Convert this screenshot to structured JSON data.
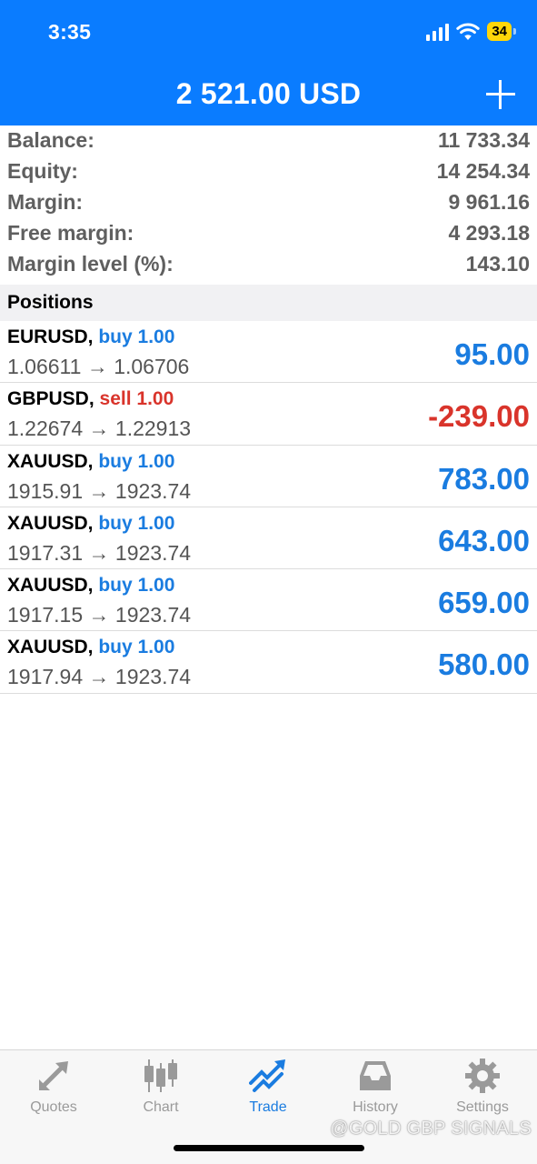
{
  "status_bar": {
    "time": "3:35",
    "battery": "34"
  },
  "header": {
    "title": "2 521.00 USD"
  },
  "summary": [
    {
      "label": "Balance:",
      "value": "11 733.34"
    },
    {
      "label": "Equity:",
      "value": "14 254.34"
    },
    {
      "label": "Margin:",
      "value": "9 961.16"
    },
    {
      "label": "Free margin:",
      "value": "4 293.18"
    },
    {
      "label": "Margin level (%):",
      "value": "143.10"
    }
  ],
  "positions_title": "Positions",
  "positions": [
    {
      "symbol": "EURUSD,",
      "direction": "buy 1.00",
      "prices": "1.06611 → 1.06706",
      "profit": "95.00"
    },
    {
      "symbol": "GBPUSD,",
      "direction": "sell 1.00",
      "prices": "1.22674 → 1.22913",
      "profit": "-239.00"
    },
    {
      "symbol": "XAUUSD,",
      "direction": "buy 1.00",
      "prices": "1915.91 → 1923.74",
      "profit": "783.00"
    },
    {
      "symbol": "XAUUSD,",
      "direction": "buy 1.00",
      "prices": "1917.31 → 1923.74",
      "profit": "643.00"
    },
    {
      "symbol": "XAUUSD,",
      "direction": "buy 1.00",
      "prices": "1917.15 → 1923.74",
      "profit": "659.00"
    },
    {
      "symbol": "XAUUSD,",
      "direction": "buy 1.00",
      "prices": "1917.94 → 1923.74",
      "profit": "580.00"
    }
  ],
  "tabs": [
    {
      "label": "Quotes",
      "icon": "quotes-arrows-icon",
      "active": false
    },
    {
      "label": "Chart",
      "icon": "candlestick-chart-icon",
      "active": false
    },
    {
      "label": "Trade",
      "icon": "trade-trend-icon",
      "active": true
    },
    {
      "label": "History",
      "icon": "history-inbox-icon",
      "active": false
    },
    {
      "label": "Settings",
      "icon": "gear-icon",
      "active": false
    }
  ],
  "watermark": "@GOLD GBP SIGNALS",
  "colors": {
    "header": "#0a7cff",
    "buy": "#1a7ce0",
    "sell": "#d9342b"
  }
}
